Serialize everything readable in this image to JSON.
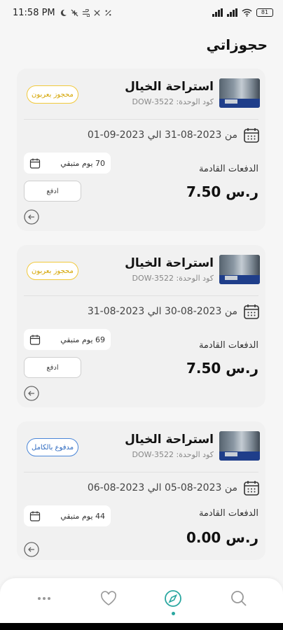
{
  "status": {
    "time": "11:58 PM",
    "battery": "81"
  },
  "page": {
    "title": "حجوزاتي"
  },
  "bookings": [
    {
      "name": "استراحة الخيال",
      "unit_code": "كود الوحدة: DOW-3522",
      "status_badge": "محجوز بعربون",
      "badge_type": "partial",
      "date_range": "من 2023-08-31 الي 2023-09-01",
      "days_left": "70 يوم متبقي",
      "payments_label": "الدفعات القادمة",
      "pay_button": "ادفع",
      "amount": "7.50 ر.س"
    },
    {
      "name": "استراحة الخيال",
      "unit_code": "كود الوحدة: DOW-3522",
      "status_badge": "محجوز بعربون",
      "badge_type": "partial",
      "date_range": "من 2023-08-30 الي 2023-08-31",
      "days_left": "69 يوم متبقي",
      "payments_label": "الدفعات القادمة",
      "pay_button": "ادفع",
      "amount": "7.50 ر.س"
    },
    {
      "name": "استراحة الخيال",
      "unit_code": "كود الوحدة: DOW-3522",
      "status_badge": "مدفوع بالكامل",
      "badge_type": "full",
      "date_range": "من 2023-08-05 الي 2023-08-06",
      "days_left": "44 يوم متبقي",
      "payments_label": "الدفعات القادمة",
      "pay_button": "",
      "amount": "0.00 ر.س"
    }
  ],
  "nav": {
    "active": "explore",
    "accent": "#2aa7a0",
    "items": [
      "more-icon",
      "heart-icon",
      "compass-icon",
      "search-icon"
    ]
  },
  "colors": {
    "partial_badge": "#f1c93b",
    "full_badge": "#4a86d8"
  }
}
